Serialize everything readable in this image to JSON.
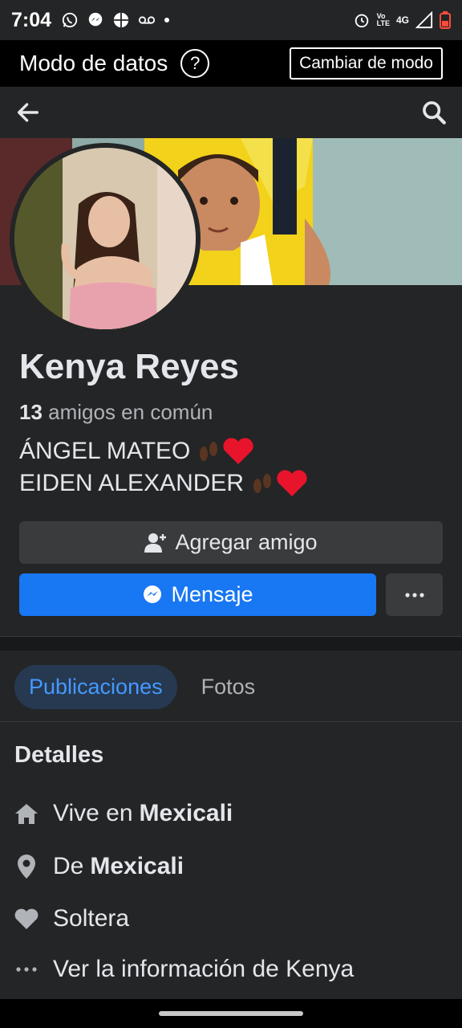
{
  "status_bar": {
    "time": "7:04",
    "volte_top": "Vo",
    "volte_bottom": "LTE",
    "network": "4G"
  },
  "data_mode": {
    "title": "Modo de datos",
    "help": "?",
    "switch_label": "Cambiar de modo"
  },
  "nav": {
    "back_icon": "arrow-left-icon",
    "search_icon": "search-icon"
  },
  "profile": {
    "name": "Kenya Reyes",
    "mutual_count": "13",
    "mutual_text": " amigos en común",
    "bio_line1": "ÁNGEL MATEO",
    "bio_line2": "EIDEN ALEXANDER "
  },
  "actions": {
    "add_friend": "Agregar amigo",
    "message": "Mensaje",
    "more": "more-icon"
  },
  "tabs": [
    {
      "label": "Publicaciones",
      "active": true
    },
    {
      "label": "Fotos",
      "active": false
    }
  ],
  "details": {
    "title": "Detalles",
    "lives_prefix": "Vive en",
    "lives_city": "Mexicali",
    "from_prefix": "De",
    "from_city": "Mexicali",
    "relationship": "Soltera",
    "see_info": "Ver la información de Kenya"
  },
  "colors": {
    "accent": "#1877f2",
    "background": "#242526",
    "tab_active_bg": "#263951",
    "tab_active_text": "#4599ff"
  }
}
